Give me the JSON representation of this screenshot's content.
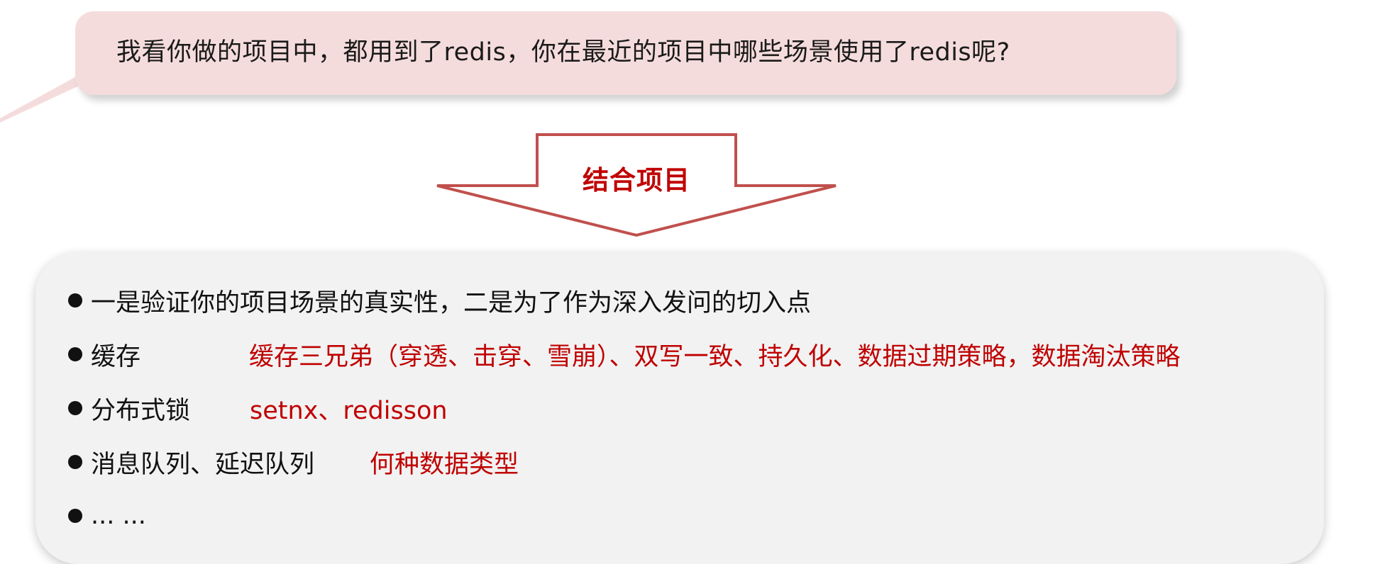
{
  "question": "我看你做的项目中，都用到了redis，你在最近的项目中哪些场景使用了redis呢?",
  "arrow": {
    "label": "结合项目"
  },
  "points": [
    {
      "label": "一是验证你的项目场景的真实性，二是为了作为深入发问的切入点",
      "detail": ""
    },
    {
      "label": "缓存",
      "detail": "缓存三兄弟（穿透、击穿、雪崩）、双写一致、持久化、数据过期策略，数据淘汰策略"
    },
    {
      "label": "分布式锁",
      "detail": "setnx、redisson"
    },
    {
      "label": "消息队列、延迟队列",
      "detail": "何种数据类型"
    },
    {
      "label": "... ...",
      "detail": ""
    }
  ],
  "colors": {
    "bubble": "#f5dcdc",
    "accent": "#c00000",
    "arrow_stroke": "#c0504d",
    "panel": "#f2f2f2"
  }
}
